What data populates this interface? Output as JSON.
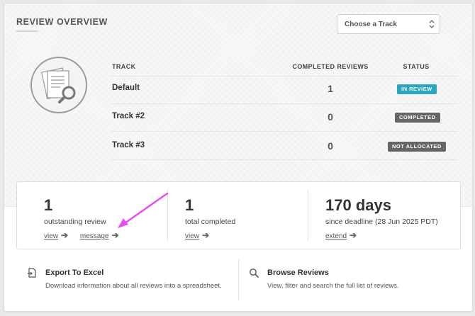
{
  "header": {
    "title": "REVIEW OVERVIEW"
  },
  "track_select": {
    "label": "Choose a Track"
  },
  "table": {
    "headers": {
      "track": "TRACK",
      "completed": "COMPLETED REVIEWS",
      "status": "STATUS"
    },
    "rows": [
      {
        "name": "Default",
        "count": "1",
        "status": "IN REVIEW",
        "status_color": "#2aa7bf"
      },
      {
        "name": "Track #2",
        "count": "0",
        "status": "COMPLETED",
        "status_color": "#666666"
      },
      {
        "name": "Track #3",
        "count": "0",
        "status": "NOT ALLOCATED",
        "status_color": "#666666"
      }
    ]
  },
  "stats": {
    "outstanding": {
      "value": "1",
      "label": "outstanding review",
      "link1": "view",
      "link2": "message"
    },
    "completed": {
      "value": "1",
      "label": "total completed",
      "link1": "view"
    },
    "deadline": {
      "value": "170 days",
      "label": "since deadline (28 Jun 2025 PDT)",
      "link1": "extend"
    }
  },
  "actions": {
    "export": {
      "title": "Export To Excel",
      "desc": "Download information about all reviews into a spreadsheet.",
      "icon": "file-export-icon"
    },
    "browse": {
      "title": "Browse Reviews",
      "desc": "View, filter and search the full list of reviews.",
      "icon": "search-icon"
    }
  },
  "annotation": {
    "arrow_color": "#e84ee8"
  }
}
